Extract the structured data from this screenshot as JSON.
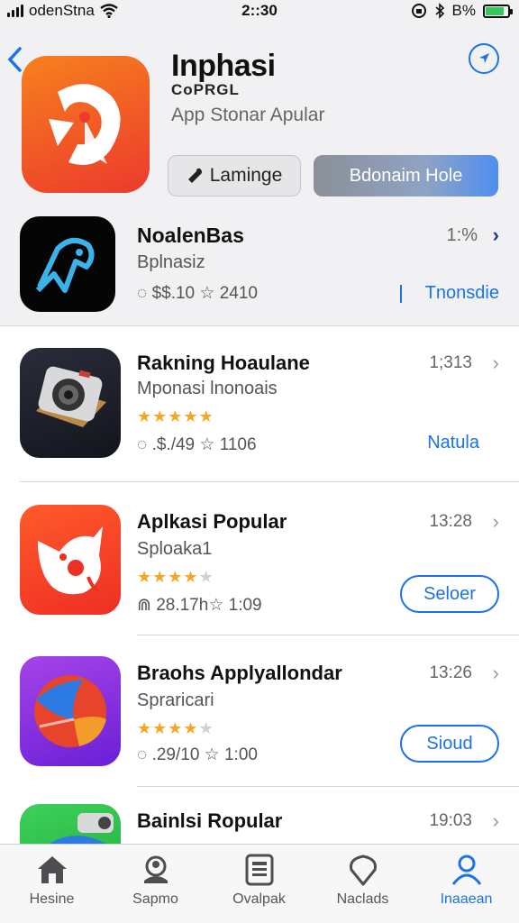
{
  "status": {
    "carrier": "odenStna",
    "time": "2::30",
    "battery_text": "B%",
    "battery_level": 0.85
  },
  "hero": {
    "title": "Inphasi",
    "subtitle": "CoPRGL",
    "category": "App Stonar Apular",
    "lang_button": "Laminge",
    "primary_button": "Bdonaim Hole"
  },
  "featured": {
    "name": "NoalenBas",
    "subtitle": "Bplnasiz",
    "meta": "$$.10 ☆ 2410",
    "time": "1:%",
    "link": "Tnonsdie"
  },
  "apps": [
    {
      "name": "Rakning Hoaulane",
      "subtitle": "Mponasi lnonoais",
      "rating": 5,
      "meta": ".$./49 ☆ 1106",
      "time": "1;313",
      "action": "Natula",
      "action_style": "text",
      "icon": "camera-app-icon"
    },
    {
      "name": "Aplkasi Popular",
      "subtitle": "Sploaka1",
      "rating": 4,
      "meta": "28.17h☆ 1:09",
      "time": "13:28",
      "action": "Seloer",
      "action_style": "button",
      "icon": "fox-app-icon"
    },
    {
      "name": "Braohs Applyallondar",
      "subtitle": "Spraricari",
      "rating": 4,
      "meta": ".29/10 ☆ 1:00",
      "time": "13:26",
      "action": "Sioud",
      "action_style": "button",
      "icon": "ball-app-icon"
    },
    {
      "name": "Bainlsi Ropular",
      "subtitle": "",
      "rating": 0,
      "meta": "",
      "time": "19:03",
      "action": "",
      "action_style": "none",
      "icon": "camera-green-app-icon"
    }
  ],
  "tabs": [
    {
      "label": "Hesine",
      "icon": "home-icon",
      "active": false
    },
    {
      "label": "Sapmo",
      "icon": "person-scan-icon",
      "active": false
    },
    {
      "label": "Ovalpak",
      "icon": "document-icon",
      "active": false
    },
    {
      "label": "Naclads",
      "icon": "location-pin-icon",
      "active": false
    },
    {
      "label": "Inaaean",
      "icon": "account-icon",
      "active": true
    }
  ],
  "colors": {
    "accent": "#1a73e8",
    "star": "#f5a623",
    "hero_icon_gradient_start": "#f7801e",
    "hero_icon_gradient_end": "#ec3a2d"
  }
}
